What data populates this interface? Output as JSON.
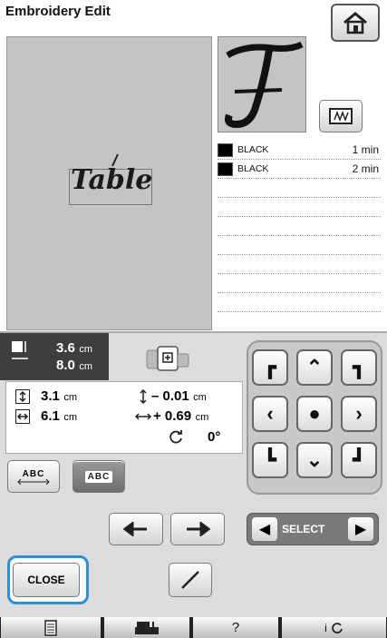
{
  "header": {
    "title": "Embroidery Edit"
  },
  "canvas": {
    "design_text": "Table"
  },
  "thread_list": [
    {
      "color_name": "BLACK",
      "time": "1 min",
      "swatch": "#000000"
    },
    {
      "color_name": "BLACK",
      "time": "2 min",
      "swatch": "#000000"
    }
  ],
  "size": {
    "height": "3.6",
    "height_unit": "cm",
    "width": "8.0",
    "width_unit": "cm"
  },
  "position": {
    "height": "3.1",
    "height_unit": "cm",
    "width": "6.1",
    "width_unit": "cm",
    "vertical_offset": "– 0.01",
    "vertical_unit": "cm",
    "horizontal_offset": "+ 0.69",
    "horizontal_unit": "cm",
    "rotation": "0°"
  },
  "text_buttons": {
    "spacing_label": "ABC",
    "split_label": "ABC"
  },
  "select": {
    "label": "SELECT"
  },
  "close": {
    "label": "CLOSE"
  },
  "bottom_bar": {
    "help": "?",
    "info": "i"
  },
  "colors": {
    "accent": "#2e8fd8",
    "panel": "#dcdcdc",
    "canvas": "#c4c4c4",
    "dark": "#3e3e3e"
  }
}
